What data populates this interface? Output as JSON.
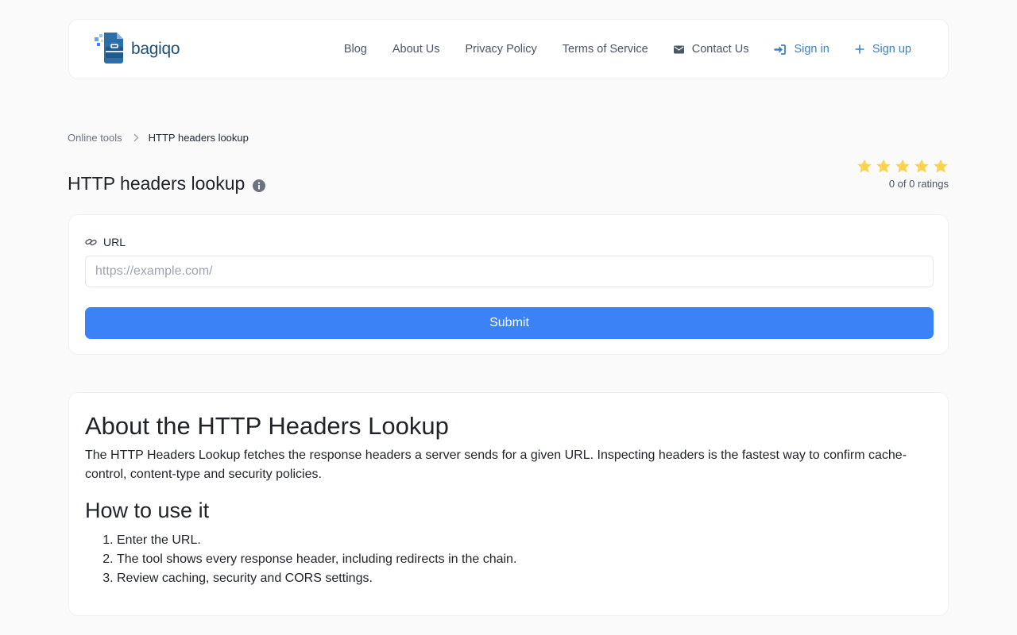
{
  "brand": {
    "name": "bagiqo",
    "logo_icon": "briefcase-logo-icon"
  },
  "nav": {
    "items": [
      {
        "label": "Blog"
      },
      {
        "label": "About Us"
      },
      {
        "label": "Privacy Policy"
      },
      {
        "label": "Terms of Service"
      },
      {
        "label": "Contact Us",
        "icon": "envelope-icon"
      },
      {
        "label": "Sign in",
        "icon": "sign-in-icon"
      },
      {
        "label": "Sign up",
        "icon": "plus-icon"
      }
    ]
  },
  "breadcrumb": {
    "parent": "Online tools",
    "current": "HTTP headers lookup"
  },
  "page": {
    "title": "HTTP headers lookup"
  },
  "rating": {
    "stars": 5,
    "text": "0 of 0 ratings",
    "star_color": "#fcd34d"
  },
  "form": {
    "url_label": "URL",
    "url_placeholder": "https://example.com/",
    "url_value": "",
    "submit_label": "Submit"
  },
  "about": {
    "title": "About the HTTP Headers Lookup",
    "paragraph": "The HTTP Headers Lookup fetches the response headers a server sends for a given URL. Inspecting headers is the fastest way to confirm cache-control, content-type and security policies.",
    "how_title": "How to use it",
    "steps": [
      "Enter the URL.",
      "The tool shows every response header, including redirects in the chain.",
      "Review caching, security and CORS settings."
    ]
  },
  "colors": {
    "accent": "#3b82f6",
    "link": "#3b82c4",
    "background": "#fafafa"
  }
}
